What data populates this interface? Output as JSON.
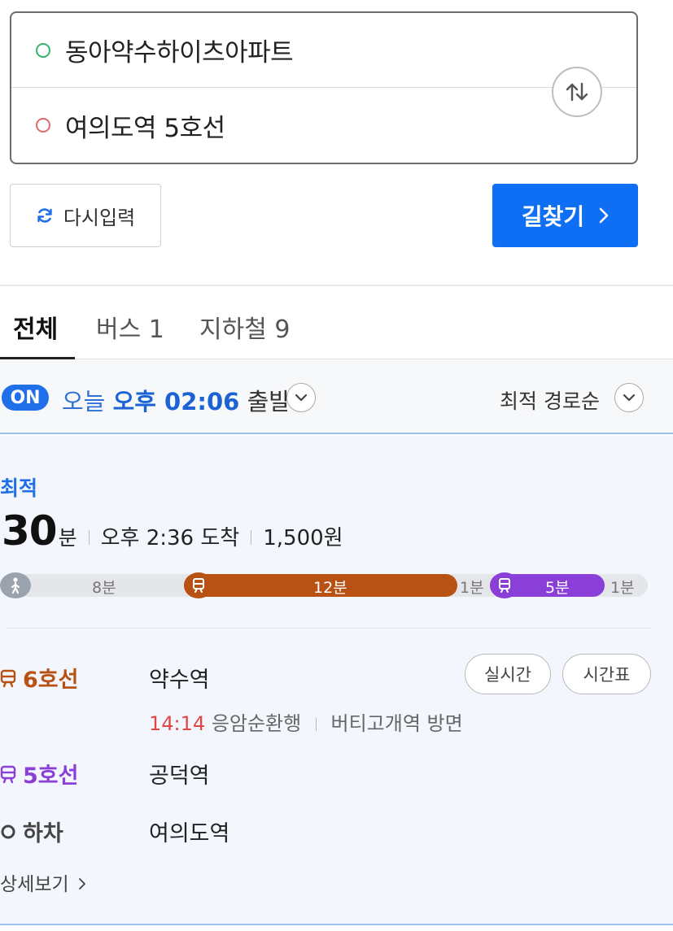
{
  "search": {
    "origin": "동아약수하이츠아파트",
    "destination": "여의도역 5호선"
  },
  "actions": {
    "reset_label": "다시입력",
    "find_label": "길찾기"
  },
  "tabs": [
    {
      "label": "전체",
      "active": true
    },
    {
      "label": "버스 1",
      "active": false
    },
    {
      "label": "지하철 9",
      "active": false
    }
  ],
  "time_bar": {
    "on_label": "ON",
    "day": "오늘",
    "time": "오후 02:06",
    "departure": "출발",
    "sort": "최적 경로순"
  },
  "route": {
    "label": "최적",
    "duration": "30",
    "duration_unit": "분",
    "arrival": "오후 2:36 도착",
    "fare": "1,500원",
    "timeline": {
      "walk1": "8분",
      "line6_time": "12분",
      "walk2": "1분",
      "line5_time": "5분",
      "walk3": "1분"
    },
    "steps": [
      {
        "line": "6호선",
        "station": "약수역",
        "color": "#b85114"
      },
      {
        "line": "5호선",
        "station": "공덕역",
        "color": "#8b3fd9"
      },
      {
        "line": "하차",
        "station": "여의도역"
      }
    ],
    "realtime_label": "실시간",
    "timetable_label": "시간표",
    "arrival_time": "14:14",
    "direction_name": "응암순환행",
    "direction": "버티고개역 방면",
    "detail_label": "상세보기"
  },
  "colors": {
    "primary": "#0e6ff5",
    "line6": "#b85114",
    "line5": "#8b3fd9",
    "highlight_red": "#e04848"
  },
  "icons": [
    "swap-icon",
    "refresh-icon",
    "chevron-right-icon",
    "chevron-down-icon",
    "walk-icon",
    "subway-icon"
  ]
}
